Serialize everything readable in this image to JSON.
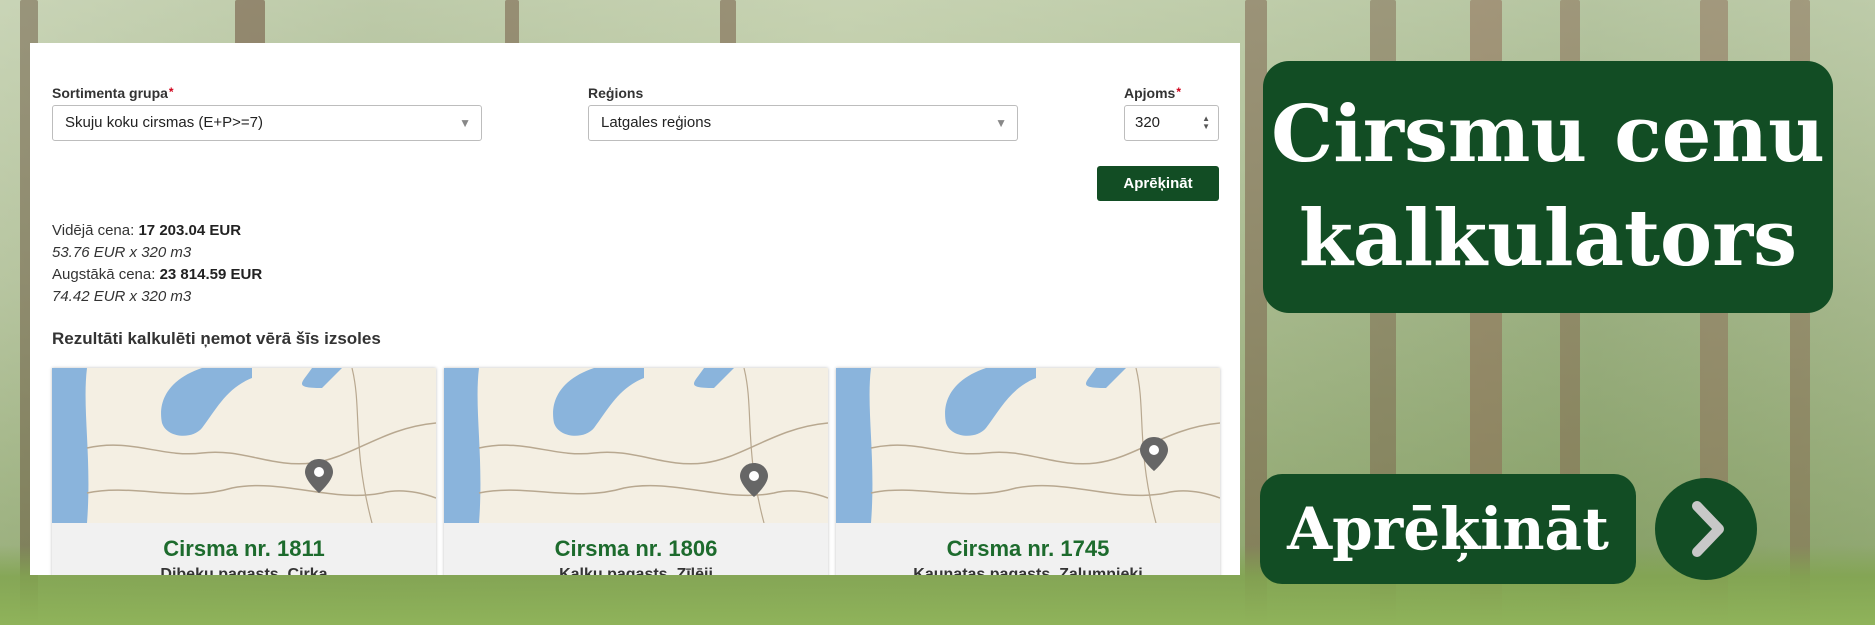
{
  "form": {
    "sortiment_label": "Sortimenta grupa",
    "sortiment_value": "Skuju koku cirsmas (E+P>=7)",
    "region_label": "Reģions",
    "region_value": "Latgales reģions",
    "volume_label": "Apjoms",
    "volume_value": "320",
    "required_mark": "*",
    "calc_button": "Aprēķināt"
  },
  "results": {
    "avg_label": "Vidējā cena:",
    "avg_value": "17 203.04 EUR",
    "avg_detail": "53.76 EUR x 320 m3",
    "max_label": "Augstākā cena:",
    "max_value": "23 814.59 EUR",
    "max_detail": "74.42 EUR x 320 m3",
    "section_title": "Rezultāti kalkulēti ņemot vērā šīs izsoles"
  },
  "cards": [
    {
      "title": "Cirsma nr. 1811",
      "subtitle": "Dibeku pagasts, Cirka"
    },
    {
      "title": "Cirsma nr. 1806",
      "subtitle": "Kaļķu pagasts, Zīlēji"
    },
    {
      "title": "Cirsma nr. 1745",
      "subtitle": "Kaunatas pagasts, Zaļumnieki"
    }
  ],
  "banner": {
    "title_line1": "Cirsmu cenu",
    "title_line2": "kalkulators",
    "cta_label": "Aprēķināt"
  },
  "colors": {
    "brand_green": "#124d24",
    "card_title_green": "#1d6b2d",
    "required_red": "#d0021b"
  },
  "icons": [
    "select-arrow-icon",
    "spinner-icon",
    "map-pin-icon",
    "chevron-right-icon"
  ]
}
